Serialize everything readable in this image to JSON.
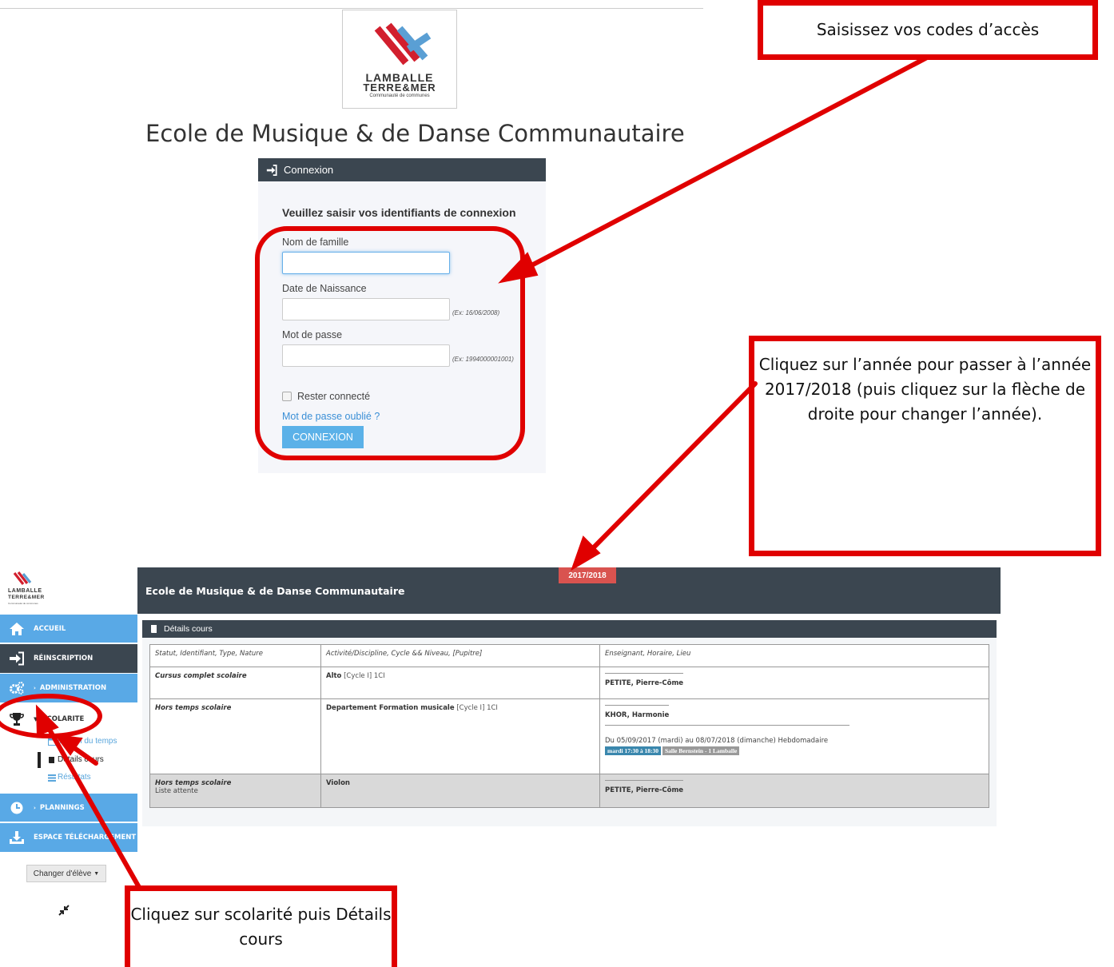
{
  "login": {
    "logo": {
      "line1": "LAMBALLE",
      "line2": "TERRE&MER",
      "line3": "Communauté de communes"
    },
    "school_title": "Ecole de Musique & de Danse Communautaire",
    "panel_title": "Connexion",
    "subtitle": "Veuillez saisir vos identifiants de connexion",
    "fields": [
      {
        "label": "Nom de famille",
        "value": "",
        "hint": ""
      },
      {
        "label": "Date de Naissance",
        "value": "",
        "hint": "(Ex: 16/06/2008)"
      },
      {
        "label": "Mot de passe",
        "value": "",
        "hint": "(Ex: 1994000001001)"
      }
    ],
    "remember_label": "Rester connecté",
    "forgot_link": "Mot de passe oublié ?",
    "submit_label": "CONNEXION"
  },
  "app": {
    "logo": {
      "line1": "LAMBALLE",
      "line2": "TERRE&MER",
      "line3": "Communauté de communes"
    },
    "header_title": "Ecole de Musique & de Danse Communautaire",
    "year_badge": "2017/2018",
    "sidebar": {
      "items": [
        {
          "label": "ACCUEIL",
          "icon": "home-icon"
        },
        {
          "label": "RÉINSCRIPTION",
          "icon": "sign-in-icon"
        },
        {
          "label": "ADMINISTRATION",
          "icon": "gears-icon"
        },
        {
          "label": "SCOLARITE",
          "icon": "trophy-icon"
        },
        {
          "label": "PLANNINGS",
          "icon": "clock-icon"
        },
        {
          "label": "ESPACE TÉLÉCHARGEMENT",
          "icon": "download-icon"
        }
      ],
      "sub_items": [
        "Emploi du temps",
        "Détails cours",
        "Résultats"
      ]
    },
    "change_student_label": "Changer d'élève",
    "details": {
      "title": "Détails cours",
      "columns": [
        "Statut, Identifiant, Type, Nature",
        "Activité/Discipline, Cycle && Niveau, [Pupitre]",
        "Enseignant, Horaire, Lieu"
      ],
      "rows": [
        {
          "status": "Cursus complet scolaire",
          "status_note": "",
          "activity": "Alto",
          "level": "[Cycle I] 1CI",
          "teacher": "PETITE, Pierre-Côme",
          "period": "",
          "slot": "",
          "room": ""
        },
        {
          "status": "Hors temps scolaire",
          "status_note": "",
          "activity": "Departement Formation musicale",
          "level": "[Cycle I] 1CI",
          "teacher": "KHOR, Harmonie",
          "period": "Du 05/09/2017 (mardi) au 08/07/2018 (dimanche) Hebdomadaire",
          "slot": "mardi 17:30 à 18:30",
          "room": "Salle Bernstein - 1 Lamballe"
        },
        {
          "status": "Hors temps scolaire",
          "status_note": "Liste attente",
          "activity": "Violon",
          "level": "",
          "teacher": "PETITE, Pierre-Côme",
          "period": "",
          "slot": "",
          "room": ""
        }
      ]
    }
  },
  "annotations": {
    "top_right": "Saisissez vos codes d’accès",
    "middle_right": "Cliquez sur l’année pour passer à l’année 2017/2018 (puis cliquez sur la flèche de droite pour changer l’année).",
    "bottom_left": "Cliquez sur scolarité puis Détails cours"
  },
  "colors": {
    "header_dark": "#3b4650",
    "sidebar_blue": "#59a9e6",
    "annotation_red": "#e00000",
    "badge_red": "#d9534f",
    "button_blue": "#5bb1e8"
  }
}
